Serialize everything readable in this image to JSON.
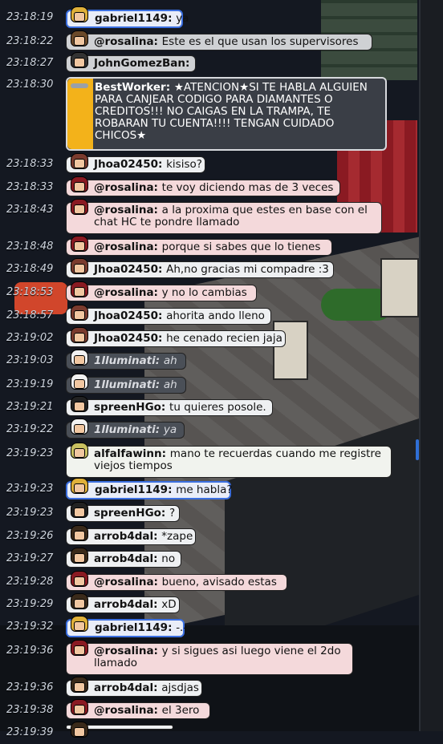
{
  "chat": {
    "messages": [
      {
        "time": "23:18:19",
        "user": "gabriel1149",
        "sep": ":",
        "text": "ya",
        "style": "blue",
        "avatar": "#e0b13a"
      },
      {
        "time": "23:18:22",
        "user": "@rosalina",
        "sep": ":",
        "text": "Este es el que usan los supervisores",
        "style": "grey",
        "avatar": "#6b4a2a"
      },
      {
        "time": "23:18:27",
        "user": "JohnGomezBan",
        "sep": ":",
        "text": "",
        "style": "grey",
        "avatar": "#333333"
      },
      {
        "time": "23:18:30",
        "user": "BestWorker",
        "sep": ":",
        "text": "★ATENCION★SI TE HABLA ALGUIEN PARA CANJEAR CODIGO PARA DIAMANTES O CREDITOS!!! NO CAIGAS EN LA TRAMPA, TE ROBARAN TU CUENTA!!!! TENGAN CUIDADO CHICOS★",
        "style": "warn",
        "avatar": "#9aa0a8"
      },
      {
        "time": "23:18:33",
        "user": "Jhoa02450",
        "sep": ":",
        "text": "kisiso?",
        "style": "white",
        "avatar": "#7a3b2e"
      },
      {
        "time": "23:18:33",
        "user": "@rosalina",
        "sep": ":",
        "text": "te voy diciendo mas de 3 veces",
        "style": "pink",
        "avatar": "#8a1a22"
      },
      {
        "time": "23:18:43",
        "user": "@rosalina",
        "sep": ":",
        "text": "a la proxima que estes en base con el chat HC te pondre llamado",
        "style": "pink",
        "avatar": "#8a1a22"
      },
      {
        "time": "23:18:48",
        "user": "@rosalina",
        "sep": ":",
        "text": "porque si sabes que lo tienes",
        "style": "pink",
        "avatar": "#8a1a22"
      },
      {
        "time": "23:18:49",
        "user": "Jhoa02450",
        "sep": ":",
        "text": "Ah,no gracias mi compadre :3",
        "style": "white",
        "avatar": "#7a3b2e"
      },
      {
        "time": "23:18:53",
        "user": "@rosalina",
        "sep": ":",
        "text": "y no lo cambias",
        "style": "pink",
        "avatar": "#8a1a22"
      },
      {
        "time": "23:18:57",
        "user": "Jhoa02450",
        "sep": ":",
        "text": "ahorita ando lleno",
        "style": "white",
        "avatar": "#7a3b2e"
      },
      {
        "time": "23:19:02",
        "user": "Jhoa02450",
        "sep": ":",
        "text": "he cenado recien jaja",
        "style": "white",
        "avatar": "#7a3b2e"
      },
      {
        "time": "23:19:03",
        "user": "1lluminati",
        "sep": ":",
        "text": "ah",
        "style": "dark",
        "avatar": "#f2f2f2"
      },
      {
        "time": "23:19:19",
        "user": "1lluminati",
        "sep": ":",
        "text": "ah",
        "style": "dark",
        "avatar": "#f2f2f2"
      },
      {
        "time": "23:19:21",
        "user": "spreenHGo",
        "sep": ":",
        "text": "tu quieres posole.",
        "style": "white",
        "avatar": "#222222"
      },
      {
        "time": "23:19:22",
        "user": "1lluminati",
        "sep": ":",
        "text": "ya",
        "style": "dark",
        "avatar": "#f2f2f2"
      },
      {
        "time": "23:19:23",
        "user": "alfalfawinn",
        "sep": ":",
        "text": "mano te recuerdas cuando me registre viejos tiempos",
        "style": "green",
        "avatar": "#c8c060"
      },
      {
        "time": "23:19:23",
        "user": "gabriel1149",
        "sep": ":",
        "text": "me habla?",
        "style": "blue",
        "avatar": "#e0b13a"
      },
      {
        "time": "23:19:23",
        "user": "spreenHGo",
        "sep": ":",
        "text": "?",
        "style": "white",
        "avatar": "#222222"
      },
      {
        "time": "23:19:26",
        "user": "arrob4dal",
        "sep": ":",
        "text": "*zape",
        "style": "white",
        "avatar": "#3a2a1a"
      },
      {
        "time": "23:19:27",
        "user": "arrob4dal",
        "sep": ":",
        "text": "no",
        "style": "white",
        "avatar": "#3a2a1a"
      },
      {
        "time": "23:19:28",
        "user": "@rosalina",
        "sep": ":",
        "text": "bueno, avisado estas",
        "style": "pink",
        "avatar": "#8a1a22"
      },
      {
        "time": "23:19:29",
        "user": "arrob4dal",
        "sep": ":",
        "text": "xD",
        "style": "white",
        "avatar": "#3a2a1a"
      },
      {
        "time": "23:19:32",
        "user": "gabriel1149",
        "sep": ":",
        "text": "-.-",
        "style": "blue",
        "avatar": "#e0b13a"
      },
      {
        "time": "23:19:36",
        "user": "@rosalina",
        "sep": ":",
        "text": "y si sigues asi luego viene el 2do llamado",
        "style": "pink",
        "avatar": "#8a1a22"
      },
      {
        "time": "23:19:36",
        "user": "arrob4dal",
        "sep": ":",
        "text": "ajsdjas",
        "style": "white",
        "avatar": "#3a2a1a"
      },
      {
        "time": "23:19:38",
        "user": "@rosalina",
        "sep": ":",
        "text": "el 3ero",
        "style": "pink",
        "avatar": "#8a1a22"
      },
      {
        "time": "23:19:39",
        "user": "",
        "sep": "",
        "text": "",
        "style": "white",
        "avatar": "#3a2a1a"
      }
    ]
  },
  "colors": {
    "accent": "#3b6fe0",
    "warning": "#f3b21a",
    "pink_bubble": "#f4d9db"
  }
}
